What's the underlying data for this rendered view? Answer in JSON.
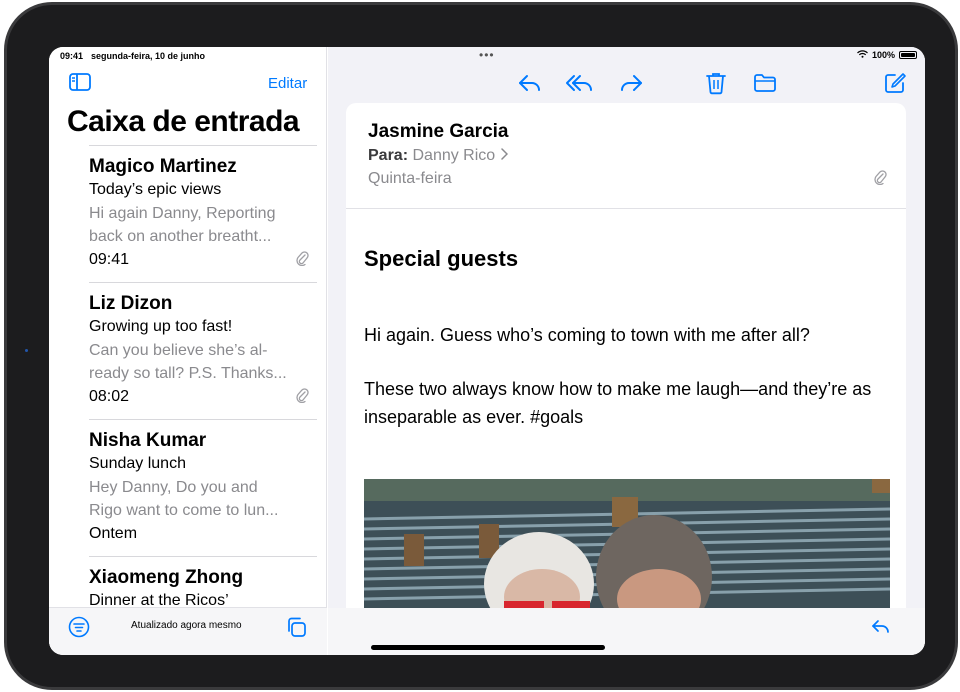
{
  "status": {
    "time": "09:41",
    "date": "segunda-feira, 10 de junho",
    "battery": "100%"
  },
  "sidebar": {
    "edit_label": "Editar",
    "title": "Caixa de entrada",
    "messages": [
      {
        "sender": "Magico Martinez",
        "subject": "Today’s epic views",
        "preview1": "Hi again Danny, Reporting",
        "preview2": "back on another breatht...",
        "time": "09:41",
        "attachment": true
      },
      {
        "sender": "Liz Dizon",
        "subject": "Growing up too fast!",
        "preview1": "Can you believe she’s al-",
        "preview2": "ready so tall? P.S. Thanks...",
        "time": "08:02",
        "attachment": true
      },
      {
        "sender": "Nisha Kumar",
        "subject": "Sunday lunch",
        "preview1": "Hey Danny, Do you and",
        "preview2": "Rigo want to come to lun...",
        "time": "Ontem",
        "attachment": false
      },
      {
        "sender": "Xiaomeng Zhong",
        "subject": "Dinner at the Ricos’",
        "preview1": "",
        "preview2": "",
        "time": "",
        "attachment": false
      }
    ],
    "updated_text": "Atualizado agora mesmo"
  },
  "toolbar": {
    "icons": [
      "reply-icon",
      "reply-all-icon",
      "forward-icon",
      "trash-icon",
      "folder-icon",
      "compose-icon",
      "more-icon"
    ]
  },
  "email": {
    "from": "Jasmine Garcia",
    "to_label": "Para:",
    "to_name": "Danny Rico",
    "date": "Quinta-feira",
    "subject": "Special guests",
    "paragraph1": "Hi again. Guess who’s coming to town with me after all?",
    "paragraph2": "These two always know how to make me laugh—and they’re as inseparable as ever. #goals"
  },
  "colors": {
    "accent": "#007aff",
    "secondary_text": "#8a8a8e",
    "separator": "#d8d8dc"
  }
}
